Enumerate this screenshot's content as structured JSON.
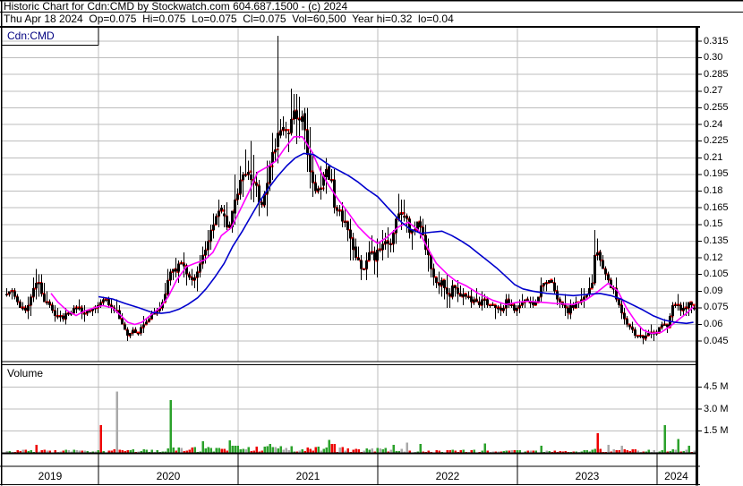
{
  "header": {
    "line1": "Historic Chart for Cdn:CMD by Stockwatch.com 604.687.1500 - (c) 2024",
    "line2": "Thu Apr 18 2024  Op=0.075  Hi=0.075  Lo=0.075  Cl=0.075  Vol=60,500  Year hi=0.32  lo=0.04"
  },
  "price_panel": {
    "symbol_label": "Cdn:CMD",
    "axis_labels": [
      "0.315",
      "0.30",
      "0.285",
      "0.27",
      "0.255",
      "0.24",
      "0.225",
      "0.21",
      "0.195",
      "0.18",
      "0.165",
      "0.15",
      "0.135",
      "0.12",
      "0.105",
      "0.09",
      "0.075",
      "0.06",
      "0.045"
    ]
  },
  "volume_panel": {
    "label": "Volume",
    "axis_labels": [
      "4.5 M",
      "3.0 M",
      "1.5 M"
    ]
  },
  "x_axis": {
    "years": [
      "2019",
      "2020",
      "2021",
      "2022",
      "2023",
      "2024"
    ]
  },
  "colors": {
    "ohlc_bar": "#000000",
    "close_tick": "#ff0000",
    "ma_fast": "#ff00ff",
    "ma_slow": "#0000cd",
    "volume_up": "#2ba12b",
    "volume_down": "#ee0000",
    "volume_neutral": "#a9a9a9",
    "grid": "#bdbdbd",
    "symbol_text": "#000080"
  },
  "chart_data": {
    "type": "ohlc",
    "title": "Historic Chart for Cdn:CMD by Stockwatch.com 604.687.1500 - (c) 2024",
    "subtitle": "Thu Apr 18 2024 Op=0.075 Hi=0.075 Lo=0.075 Cl=0.075 Vol=60,500 Year hi=0.32 lo=0.04",
    "symbol": "Cdn:CMD",
    "last_trade": {
      "date": "Thu Apr 18 2024",
      "open": 0.075,
      "high": 0.075,
      "low": 0.075,
      "close": 0.075,
      "volume": 60500,
      "year_high": 0.32,
      "year_low": 0.04
    },
    "x_range_decimal_years": [
      2019.34,
      2024.3
    ],
    "x_year_labels": [
      2019,
      2020,
      2021,
      2022,
      2023,
      2024
    ],
    "price_axis": {
      "ticks": [
        0.315,
        0.3,
        0.285,
        0.27,
        0.255,
        0.24,
        0.225,
        0.21,
        0.195,
        0.18,
        0.165,
        0.15,
        0.135,
        0.12,
        0.105,
        0.09,
        0.075,
        0.06,
        0.045
      ],
      "step": 0.015,
      "ylim": [
        0.03,
        0.33
      ]
    },
    "volume_axis": {
      "ticks_millions": [
        4.5,
        3.0,
        1.5
      ],
      "ylim_millions": [
        0,
        6.0
      ]
    },
    "price_close_keypoints": [
      [
        2019.34,
        0.088
      ],
      [
        2019.37,
        0.092
      ],
      [
        2019.41,
        0.08
      ],
      [
        2019.45,
        0.072
      ],
      [
        2019.49,
        0.075
      ],
      [
        2019.53,
        0.09
      ],
      [
        2019.55,
        0.1
      ],
      [
        2019.58,
        0.095
      ],
      [
        2019.62,
        0.08
      ],
      [
        2019.65,
        0.075
      ],
      [
        2019.69,
        0.068
      ],
      [
        2019.73,
        0.065
      ],
      [
        2019.78,
        0.07
      ],
      [
        2019.82,
        0.073
      ],
      [
        2019.86,
        0.075
      ],
      [
        2019.9,
        0.07
      ],
      [
        2019.94,
        0.072
      ],
      [
        2019.97,
        0.075
      ],
      [
        2020.01,
        0.08
      ],
      [
        2020.05,
        0.082
      ],
      [
        2020.09,
        0.075
      ],
      [
        2020.13,
        0.07
      ],
      [
        2020.17,
        0.06
      ],
      [
        2020.21,
        0.05
      ],
      [
        2020.24,
        0.055
      ],
      [
        2020.28,
        0.052
      ],
      [
        2020.32,
        0.06
      ],
      [
        2020.36,
        0.066
      ],
      [
        2020.4,
        0.07
      ],
      [
        2020.44,
        0.075
      ],
      [
        2020.47,
        0.085
      ],
      [
        2020.51,
        0.105
      ],
      [
        2020.55,
        0.11
      ],
      [
        2020.59,
        0.12
      ],
      [
        2020.63,
        0.105
      ],
      [
        2020.67,
        0.1
      ],
      [
        2020.71,
        0.11
      ],
      [
        2020.74,
        0.12
      ],
      [
        2020.78,
        0.13
      ],
      [
        2020.82,
        0.15
      ],
      [
        2020.86,
        0.16
      ],
      [
        2020.9,
        0.155
      ],
      [
        2020.94,
        0.15
      ],
      [
        2020.97,
        0.165
      ],
      [
        2021.01,
        0.185
      ],
      [
        2021.05,
        0.2
      ],
      [
        2021.09,
        0.195
      ],
      [
        2021.13,
        0.18
      ],
      [
        2021.17,
        0.17
      ],
      [
        2021.21,
        0.19
      ],
      [
        2021.24,
        0.21
      ],
      [
        2021.28,
        0.225
      ],
      [
        2021.31,
        0.24
      ],
      [
        2021.33,
        0.23
      ],
      [
        2021.36,
        0.235
      ],
      [
        2021.38,
        0.245
      ],
      [
        2021.41,
        0.25
      ],
      [
        2021.44,
        0.245
      ],
      [
        2021.46,
        0.25
      ],
      [
        2021.49,
        0.22
      ],
      [
        2021.51,
        0.2
      ],
      [
        2021.54,
        0.19
      ],
      [
        2021.56,
        0.175
      ],
      [
        2021.59,
        0.185
      ],
      [
        2021.62,
        0.195
      ],
      [
        2021.64,
        0.2
      ],
      [
        2021.67,
        0.185
      ],
      [
        2021.69,
        0.17
      ],
      [
        2021.72,
        0.165
      ],
      [
        2021.74,
        0.155
      ],
      [
        2021.77,
        0.15
      ],
      [
        2021.79,
        0.145
      ],
      [
        2021.82,
        0.13
      ],
      [
        2021.85,
        0.12
      ],
      [
        2021.87,
        0.115
      ],
      [
        2021.9,
        0.11
      ],
      [
        2021.92,
        0.12
      ],
      [
        2021.95,
        0.125
      ],
      [
        2021.97,
        0.12
      ],
      [
        2022.0,
        0.125
      ],
      [
        2022.03,
        0.13
      ],
      [
        2022.05,
        0.14
      ],
      [
        2022.08,
        0.13
      ],
      [
        2022.1,
        0.135
      ],
      [
        2022.13,
        0.15
      ],
      [
        2022.15,
        0.16
      ],
      [
        2022.18,
        0.165
      ],
      [
        2022.21,
        0.15
      ],
      [
        2022.23,
        0.145
      ],
      [
        2022.26,
        0.14
      ],
      [
        2022.28,
        0.15
      ],
      [
        2022.31,
        0.145
      ],
      [
        2022.33,
        0.135
      ],
      [
        2022.36,
        0.12
      ],
      [
        2022.38,
        0.11
      ],
      [
        2022.41,
        0.1
      ],
      [
        2022.44,
        0.095
      ],
      [
        2022.46,
        0.1
      ],
      [
        2022.49,
        0.09
      ],
      [
        2022.51,
        0.085
      ],
      [
        2022.54,
        0.095
      ],
      [
        2022.56,
        0.09
      ],
      [
        2022.59,
        0.085
      ],
      [
        2022.62,
        0.09
      ],
      [
        2022.64,
        0.085
      ],
      [
        2022.67,
        0.08
      ],
      [
        2022.69,
        0.085
      ],
      [
        2022.72,
        0.08
      ],
      [
        2022.74,
        0.082
      ],
      [
        2022.77,
        0.08
      ],
      [
        2022.79,
        0.078
      ],
      [
        2022.82,
        0.08
      ],
      [
        2022.85,
        0.075
      ],
      [
        2022.87,
        0.072
      ],
      [
        2022.9,
        0.075
      ],
      [
        2022.92,
        0.08
      ],
      [
        2022.95,
        0.078
      ],
      [
        2022.97,
        0.072
      ],
      [
        2023.0,
        0.075
      ],
      [
        2023.03,
        0.08
      ],
      [
        2023.05,
        0.085
      ],
      [
        2023.08,
        0.08
      ],
      [
        2023.1,
        0.078
      ],
      [
        2023.13,
        0.08
      ],
      [
        2023.15,
        0.085
      ],
      [
        2023.18,
        0.1
      ],
      [
        2023.21,
        0.095
      ],
      [
        2023.23,
        0.1
      ],
      [
        2023.26,
        0.095
      ],
      [
        2023.28,
        0.085
      ],
      [
        2023.31,
        0.078
      ],
      [
        2023.33,
        0.075
      ],
      [
        2023.36,
        0.072
      ],
      [
        2023.38,
        0.075
      ],
      [
        2023.41,
        0.078
      ],
      [
        2023.44,
        0.08
      ],
      [
        2023.46,
        0.082
      ],
      [
        2023.49,
        0.085
      ],
      [
        2023.51,
        0.09
      ],
      [
        2023.54,
        0.1
      ],
      [
        2023.56,
        0.13
      ],
      [
        2023.59,
        0.12
      ],
      [
        2023.62,
        0.11
      ],
      [
        2023.64,
        0.1
      ],
      [
        2023.67,
        0.095
      ],
      [
        2023.69,
        0.09
      ],
      [
        2023.72,
        0.08
      ],
      [
        2023.74,
        0.07
      ],
      [
        2023.77,
        0.065
      ],
      [
        2023.79,
        0.06
      ],
      [
        2023.82,
        0.055
      ],
      [
        2023.85,
        0.05
      ],
      [
        2023.87,
        0.052
      ],
      [
        2023.9,
        0.048
      ],
      [
        2023.92,
        0.05
      ],
      [
        2023.95,
        0.055
      ],
      [
        2023.97,
        0.052
      ],
      [
        2024.0,
        0.055
      ],
      [
        2024.03,
        0.06
      ],
      [
        2024.05,
        0.058
      ],
      [
        2024.08,
        0.06
      ],
      [
        2024.1,
        0.072
      ],
      [
        2024.13,
        0.078
      ],
      [
        2024.15,
        0.075
      ],
      [
        2024.18,
        0.072
      ],
      [
        2024.21,
        0.075
      ],
      [
        2024.23,
        0.078
      ],
      [
        2024.26,
        0.075
      ]
    ],
    "price_extremes": [
      {
        "year": 2019.55,
        "high": 0.108
      },
      {
        "year": 2020.21,
        "low": 0.045
      },
      {
        "year": 2021.29,
        "high": 0.32
      },
      {
        "year": 2022.18,
        "high": 0.172
      },
      {
        "year": 2023.56,
        "high": 0.145
      },
      {
        "year": 2023.9,
        "low": 0.042
      }
    ],
    "ma_fast_points": [
      [
        2019.66,
        0.088
      ],
      [
        2019.71,
        0.08
      ],
      [
        2019.78,
        0.072
      ],
      [
        2019.84,
        0.068
      ],
      [
        2019.9,
        0.072
      ],
      [
        2019.97,
        0.075
      ],
      [
        2020.03,
        0.077
      ],
      [
        2020.1,
        0.075
      ],
      [
        2020.16,
        0.068
      ],
      [
        2020.21,
        0.062
      ],
      [
        2020.26,
        0.06
      ],
      [
        2020.31,
        0.062
      ],
      [
        2020.37,
        0.068
      ],
      [
        2020.44,
        0.075
      ],
      [
        2020.5,
        0.085
      ],
      [
        2020.56,
        0.1
      ],
      [
        2020.63,
        0.112
      ],
      [
        2020.69,
        0.115
      ],
      [
        2020.76,
        0.118
      ],
      [
        2020.82,
        0.125
      ],
      [
        2020.88,
        0.14
      ],
      [
        2020.95,
        0.147
      ],
      [
        2021.01,
        0.162
      ],
      [
        2021.08,
        0.18
      ],
      [
        2021.14,
        0.197
      ],
      [
        2021.21,
        0.202
      ],
      [
        2021.27,
        0.207
      ],
      [
        2021.33,
        0.218
      ],
      [
        2021.4,
        0.229
      ],
      [
        2021.46,
        0.229
      ],
      [
        2021.53,
        0.215
      ],
      [
        2021.59,
        0.198
      ],
      [
        2021.65,
        0.185
      ],
      [
        2021.72,
        0.172
      ],
      [
        2021.78,
        0.162
      ],
      [
        2021.86,
        0.148
      ],
      [
        2021.94,
        0.138
      ],
      [
        2022.0,
        0.133
      ],
      [
        2022.06,
        0.138
      ],
      [
        2022.15,
        0.148
      ],
      [
        2022.22,
        0.152
      ],
      [
        2022.29,
        0.145
      ],
      [
        2022.36,
        0.128
      ],
      [
        2022.42,
        0.115
      ],
      [
        2022.5,
        0.105
      ],
      [
        2022.56,
        0.099
      ],
      [
        2022.63,
        0.095
      ],
      [
        2022.72,
        0.088
      ],
      [
        2022.82,
        0.082
      ],
      [
        2022.92,
        0.078
      ],
      [
        2023.0,
        0.08
      ],
      [
        2023.08,
        0.081
      ],
      [
        2023.17,
        0.08
      ],
      [
        2023.27,
        0.079
      ],
      [
        2023.4,
        0.078
      ],
      [
        2023.49,
        0.082
      ],
      [
        2023.58,
        0.09
      ],
      [
        2023.65,
        0.097
      ],
      [
        2023.72,
        0.09
      ],
      [
        2023.78,
        0.075
      ],
      [
        2023.85,
        0.062
      ],
      [
        2023.9,
        0.055
      ],
      [
        2023.96,
        0.052
      ],
      [
        2024.03,
        0.053
      ],
      [
        2024.09,
        0.058
      ],
      [
        2024.15,
        0.064
      ],
      [
        2024.22,
        0.071
      ],
      [
        2024.26,
        0.076
      ]
    ],
    "ma_slow_points": [
      [
        2020.0,
        0.085
      ],
      [
        2020.1,
        0.083
      ],
      [
        2020.19,
        0.079
      ],
      [
        2020.29,
        0.075
      ],
      [
        2020.38,
        0.071
      ],
      [
        2020.45,
        0.07
      ],
      [
        2020.51,
        0.071
      ],
      [
        2020.58,
        0.074
      ],
      [
        2020.64,
        0.078
      ],
      [
        2020.71,
        0.084
      ],
      [
        2020.77,
        0.092
      ],
      [
        2020.83,
        0.102
      ],
      [
        2020.9,
        0.115
      ],
      [
        2020.96,
        0.13
      ],
      [
        2021.03,
        0.144
      ],
      [
        2021.09,
        0.157
      ],
      [
        2021.15,
        0.17
      ],
      [
        2021.22,
        0.183
      ],
      [
        2021.28,
        0.193
      ],
      [
        2021.35,
        0.203
      ],
      [
        2021.41,
        0.21
      ],
      [
        2021.47,
        0.214
      ],
      [
        2021.54,
        0.213
      ],
      [
        2021.6,
        0.208
      ],
      [
        2021.67,
        0.202
      ],
      [
        2021.73,
        0.198
      ],
      [
        2021.79,
        0.194
      ],
      [
        2021.86,
        0.188
      ],
      [
        2021.92,
        0.182
      ],
      [
        2022.0,
        0.175
      ],
      [
        2022.08,
        0.164
      ],
      [
        2022.17,
        0.152
      ],
      [
        2022.23,
        0.146
      ],
      [
        2022.31,
        0.142
      ],
      [
        2022.38,
        0.143
      ],
      [
        2022.46,
        0.144
      ],
      [
        2022.53,
        0.14
      ],
      [
        2022.6,
        0.135
      ],
      [
        2022.66,
        0.13
      ],
      [
        2022.72,
        0.124
      ],
      [
        2022.78,
        0.118
      ],
      [
        2022.85,
        0.111
      ],
      [
        2022.92,
        0.103
      ],
      [
        2022.98,
        0.096
      ],
      [
        2023.04,
        0.092
      ],
      [
        2023.11,
        0.09
      ],
      [
        2023.21,
        0.088
      ],
      [
        2023.3,
        0.087
      ],
      [
        2023.4,
        0.086
      ],
      [
        2023.49,
        0.087
      ],
      [
        2023.59,
        0.088
      ],
      [
        2023.67,
        0.086
      ],
      [
        2023.74,
        0.083
      ],
      [
        2023.82,
        0.078
      ],
      [
        2023.9,
        0.073
      ],
      [
        2023.97,
        0.068
      ],
      [
        2024.05,
        0.064
      ],
      [
        2024.13,
        0.062
      ],
      [
        2024.21,
        0.061
      ],
      [
        2024.26,
        0.062
      ]
    ],
    "volume_base_envelope_millions": [
      [
        2019.34,
        0.12
      ],
      [
        2019.8,
        0.1
      ],
      [
        2020.2,
        0.12
      ],
      [
        2020.6,
        0.22
      ],
      [
        2021.0,
        0.25
      ],
      [
        2021.5,
        0.22
      ],
      [
        2022.0,
        0.18
      ],
      [
        2022.5,
        0.12
      ],
      [
        2023.0,
        0.1
      ],
      [
        2023.5,
        0.14
      ],
      [
        2024.0,
        0.12
      ],
      [
        2024.26,
        0.18
      ]
    ],
    "volume_spikes": [
      {
        "year": 2019.55,
        "millions": 0.55,
        "dir": "down"
      },
      {
        "year": 2020.02,
        "millions": 1.9,
        "dir": "down"
      },
      {
        "year": 2020.13,
        "millions": 4.2,
        "dir": "neutral"
      },
      {
        "year": 2020.51,
        "millions": 3.6,
        "dir": "up"
      },
      {
        "year": 2020.74,
        "millions": 0.8,
        "dir": "up"
      },
      {
        "year": 2020.94,
        "millions": 0.85,
        "dir": "up"
      },
      {
        "year": 2021.22,
        "millions": 0.6,
        "dir": "up"
      },
      {
        "year": 2021.65,
        "millions": 0.9,
        "dir": "up"
      },
      {
        "year": 2021.68,
        "millions": 0.6,
        "dir": "down"
      },
      {
        "year": 2022.12,
        "millions": 0.55,
        "dir": "up"
      },
      {
        "year": 2022.21,
        "millions": 0.7,
        "dir": "neutral"
      },
      {
        "year": 2022.31,
        "millions": 0.6,
        "dir": "up"
      },
      {
        "year": 2022.76,
        "millions": 0.65,
        "dir": "up"
      },
      {
        "year": 2023.17,
        "millions": 0.5,
        "dir": "up"
      },
      {
        "year": 2023.57,
        "millions": 1.35,
        "dir": "down"
      },
      {
        "year": 2023.65,
        "millions": 0.55,
        "dir": "neutral"
      },
      {
        "year": 2023.75,
        "millions": 0.5,
        "dir": "neutral"
      },
      {
        "year": 2024.05,
        "millions": 1.9,
        "dir": "up"
      },
      {
        "year": 2024.15,
        "millions": 0.95,
        "dir": "up"
      },
      {
        "year": 2024.23,
        "millions": 0.5,
        "dir": "up"
      }
    ],
    "grid": true,
    "legend_position": "none"
  }
}
